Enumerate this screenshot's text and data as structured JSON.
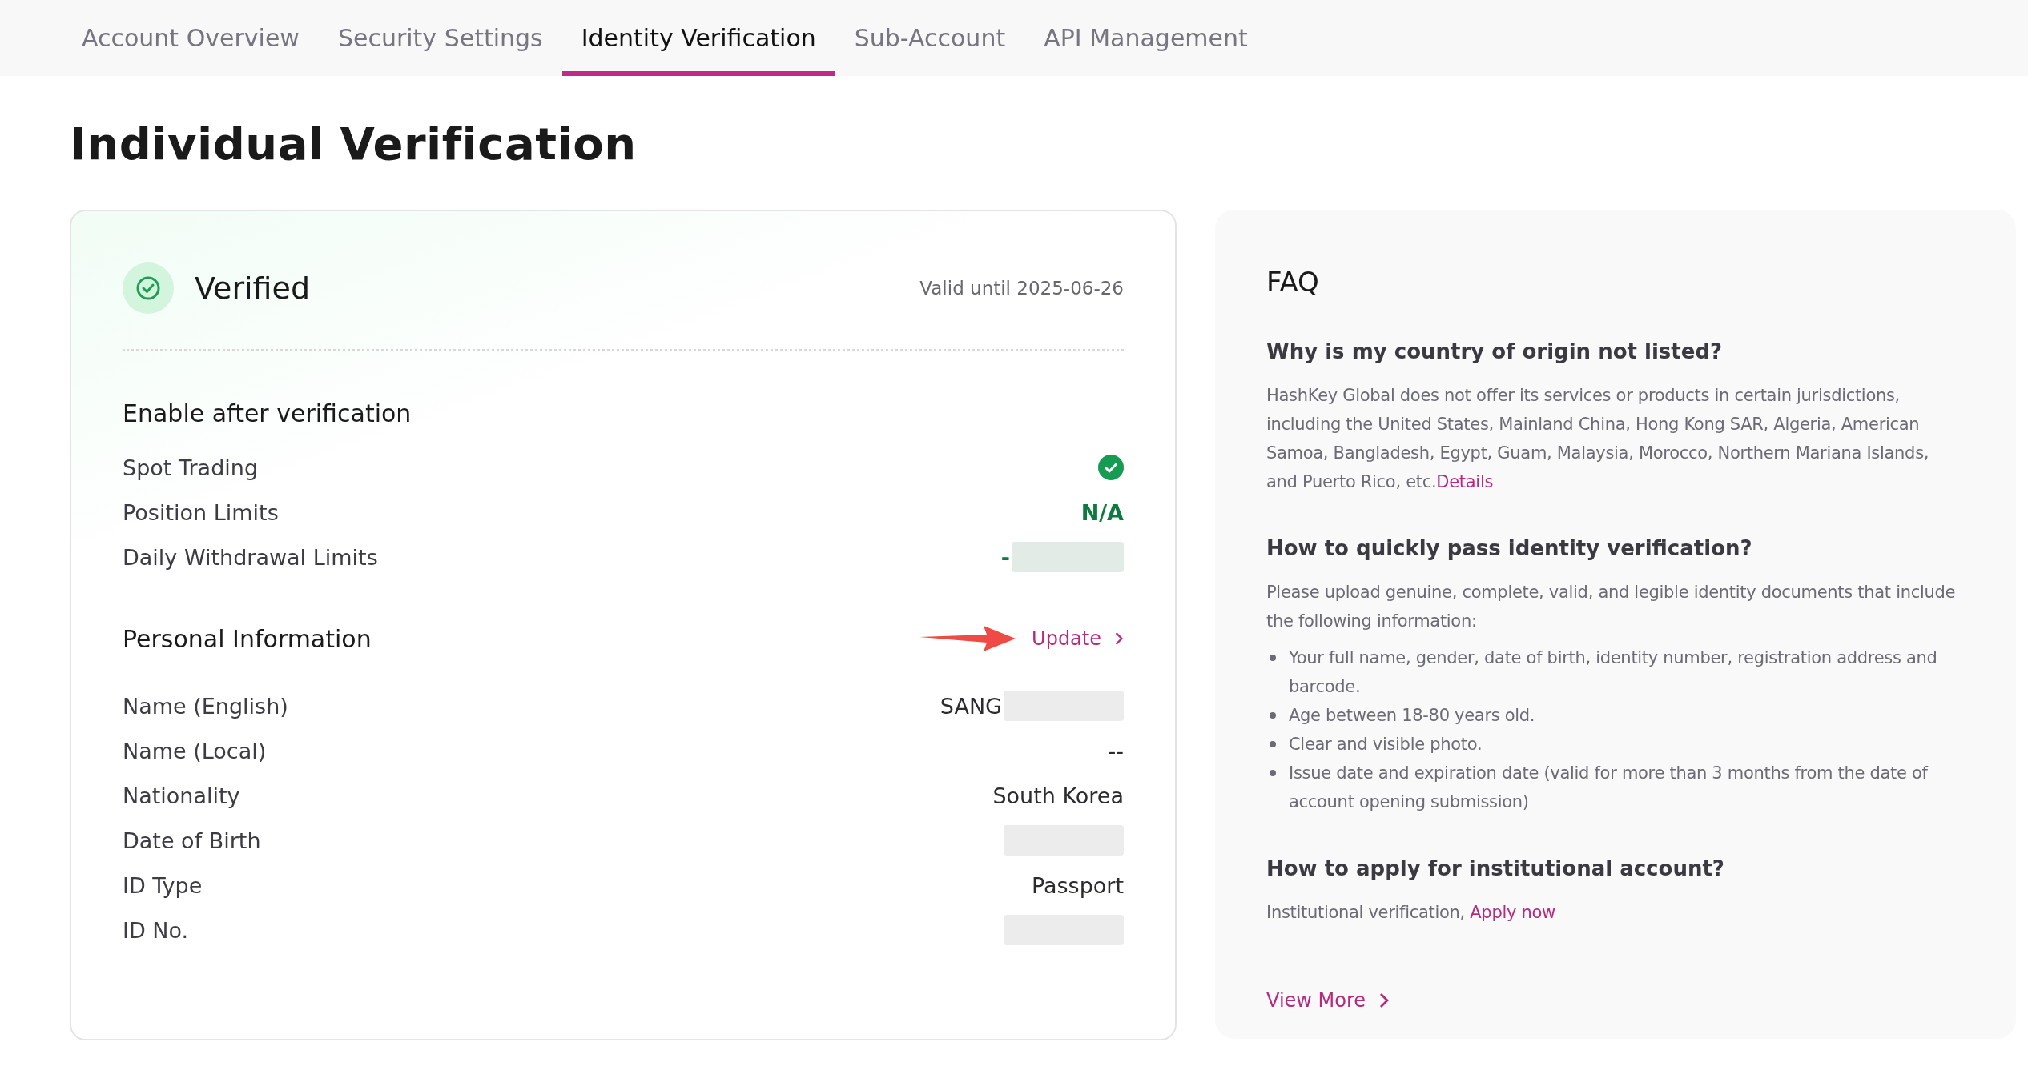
{
  "tabs": [
    {
      "label": "Account Overview",
      "selected": false
    },
    {
      "label": "Security Settings",
      "selected": false
    },
    {
      "label": "Identity Verification",
      "selected": true
    },
    {
      "label": "Sub-Account",
      "selected": false
    },
    {
      "label": "API Management",
      "selected": false
    }
  ],
  "heading": "Individual Verification",
  "status": {
    "label": "Verified",
    "verified": true,
    "valid_until": "Valid until 2025-06-26"
  },
  "features": {
    "title": "Enable after verification",
    "rows": [
      {
        "label": "Spot Trading",
        "kind": "check"
      },
      {
        "label": "Position Limits",
        "kind": "text",
        "value": "N/A"
      },
      {
        "label": "Daily Withdrawal Limits",
        "kind": "text",
        "value": "-",
        "redacted": true
      }
    ]
  },
  "personal_info": {
    "title": "Personal Information",
    "update": "Update",
    "pointer_arrow": true,
    "rows": [
      {
        "label": "Name (English)",
        "value": "SANG",
        "redacted": true
      },
      {
        "label": "Name (Local)",
        "value": "--",
        "redacted": false
      },
      {
        "label": "Nationality",
        "value": "South Korea",
        "redacted": false
      },
      {
        "label": "Date of Birth",
        "redacted": true
      },
      {
        "label": "ID Type",
        "value": "Passport",
        "redacted": false
      },
      {
        "label": "ID No.",
        "redacted": true
      }
    ]
  },
  "faq": {
    "title": "FAQ",
    "items": [
      {
        "question": "Why is my country of origin not listed?",
        "answer": "HashKey Global does not offer its services or products in certain jurisdictions, including the United States, Mainland China, Hong Kong SAR, Algeria, American Samoa, Bangladesh, Egypt, Guam, Malaysia, Morocco, Northern Mariana Islands, and Puerto Rico, etc.",
        "link": "Details"
      },
      {
        "question": "How to quickly pass identity verification?",
        "answer": "Please upload genuine, complete, valid, and legible identity documents that include the following information:",
        "bullets": [
          "Your full name, gender, date of birth, identity number, registration address and barcode.",
          "Age between 18-80 years old.",
          "Clear and visible photo.",
          "Issue date and expiration date (valid for more than 3 months from the date of account opening submission)"
        ]
      },
      {
        "question": "How to apply for institutional account?",
        "answer": "Institutional verification, ",
        "link": "Apply now"
      }
    ],
    "view_more": "View More"
  }
}
